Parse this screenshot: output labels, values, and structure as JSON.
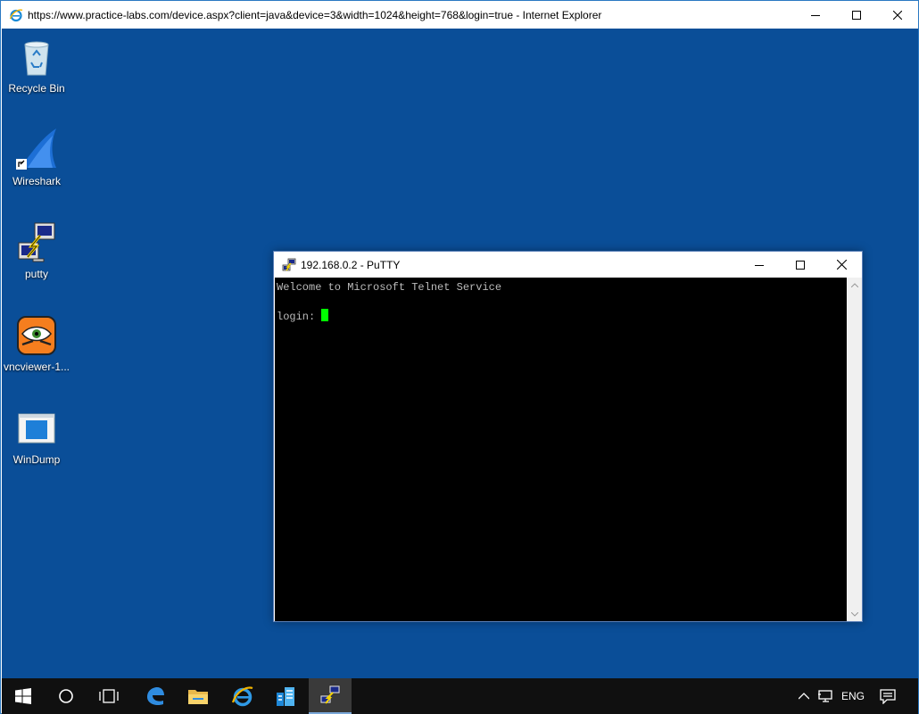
{
  "ie": {
    "title": "https://www.practice-labs.com/device.aspx?client=java&device=3&width=1024&height=768&login=true - Internet Explorer"
  },
  "desktop": {
    "background": "#0a4e98",
    "icons": [
      {
        "label": "Recycle Bin",
        "icon": "recycle-bin-icon"
      },
      {
        "label": "Wireshark",
        "icon": "wireshark-icon"
      },
      {
        "label": "putty",
        "icon": "putty-icon"
      },
      {
        "label": "vncviewer-1...",
        "icon": "vncviewer-icon"
      },
      {
        "label": "WinDump",
        "icon": "windump-icon"
      }
    ]
  },
  "putty": {
    "title": "192.168.0.2 - PuTTY",
    "lines": [
      "Welcome to Microsoft Telnet Service",
      "",
      "login: "
    ],
    "cursor_color": "#00ff00"
  },
  "taskbar": {
    "buttons": [
      "start-icon",
      "search-icon",
      "task-view-icon",
      "edge-icon",
      "file-explorer-icon",
      "internet-explorer-icon",
      "server-manager-icon",
      "putty-icon"
    ],
    "tray": {
      "language": "ENG"
    }
  }
}
